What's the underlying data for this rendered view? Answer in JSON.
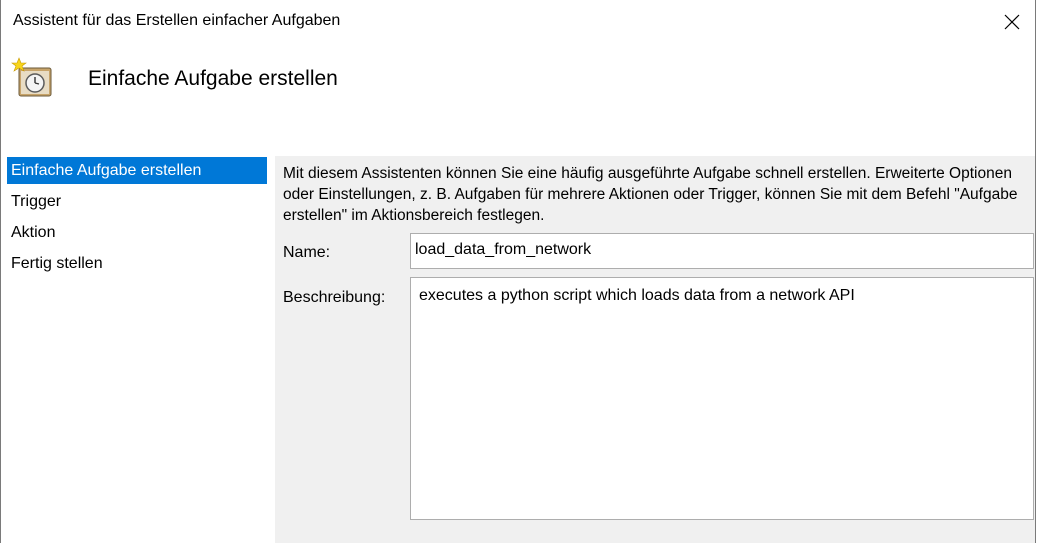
{
  "window": {
    "title": "Assistent für das Erstellen einfacher Aufgaben",
    "close_icon": "close-icon"
  },
  "header": {
    "icon": "task-scheduler-icon",
    "title": "Einfache Aufgabe erstellen"
  },
  "nav": {
    "items": [
      {
        "label": "Einfache Aufgabe erstellen",
        "active": true
      },
      {
        "label": "Trigger",
        "active": false
      },
      {
        "label": "Aktion",
        "active": false
      },
      {
        "label": "Fertig stellen",
        "active": false
      }
    ]
  },
  "content": {
    "description": "Mit diesem Assistenten können Sie eine häufig ausgeführte Aufgabe schnell erstellen. Erweiterte Optionen oder Einstellungen, z. B. Aufgaben für mehrere Aktionen oder Trigger, können Sie mit dem Befehl \"Aufgabe erstellen\" im Aktionsbereich festlegen.",
    "name_label": "Name:",
    "name_value": "load_data_from_network",
    "beschreibung_label": "Beschreibung:",
    "beschreibung_value": "executes a python script which loads data from a network API"
  },
  "colors": {
    "accent": "#0078d7",
    "panel_bg": "#f0f0f0"
  }
}
